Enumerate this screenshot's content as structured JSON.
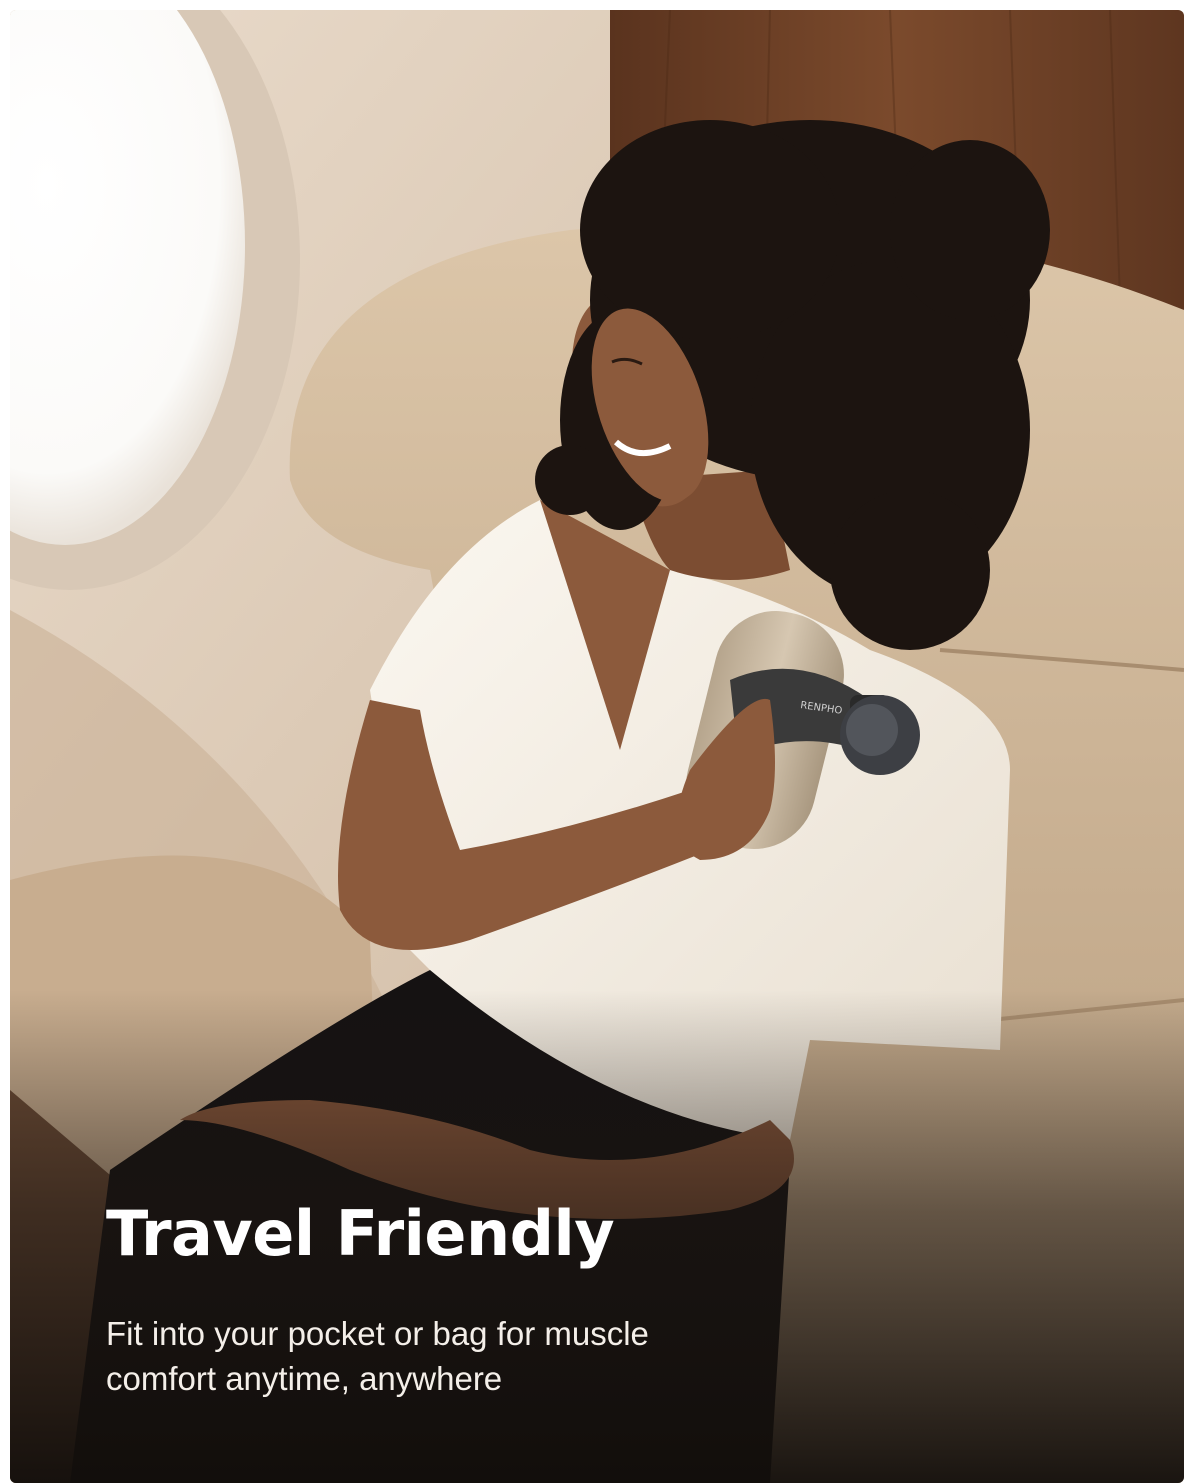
{
  "promo": {
    "headline": "Travel Friendly",
    "subline": "Fit into your pocket or bag for muscle comfort anytime, anywhere"
  },
  "device": {
    "brand_mark": "RENPHO"
  },
  "colors": {
    "cabin_wall": "#e3d3c1",
    "wood_panel": "#6b3f25",
    "seat_leather": "#d4bb9c",
    "blouse": "#f6f0e6",
    "skirt": "#151212",
    "skin": "#8c5a3c",
    "hair": "#1c1410",
    "device_body": "#c8b79f",
    "device_band": "#3a3a3a",
    "overlay_dark": "#1a1410"
  }
}
